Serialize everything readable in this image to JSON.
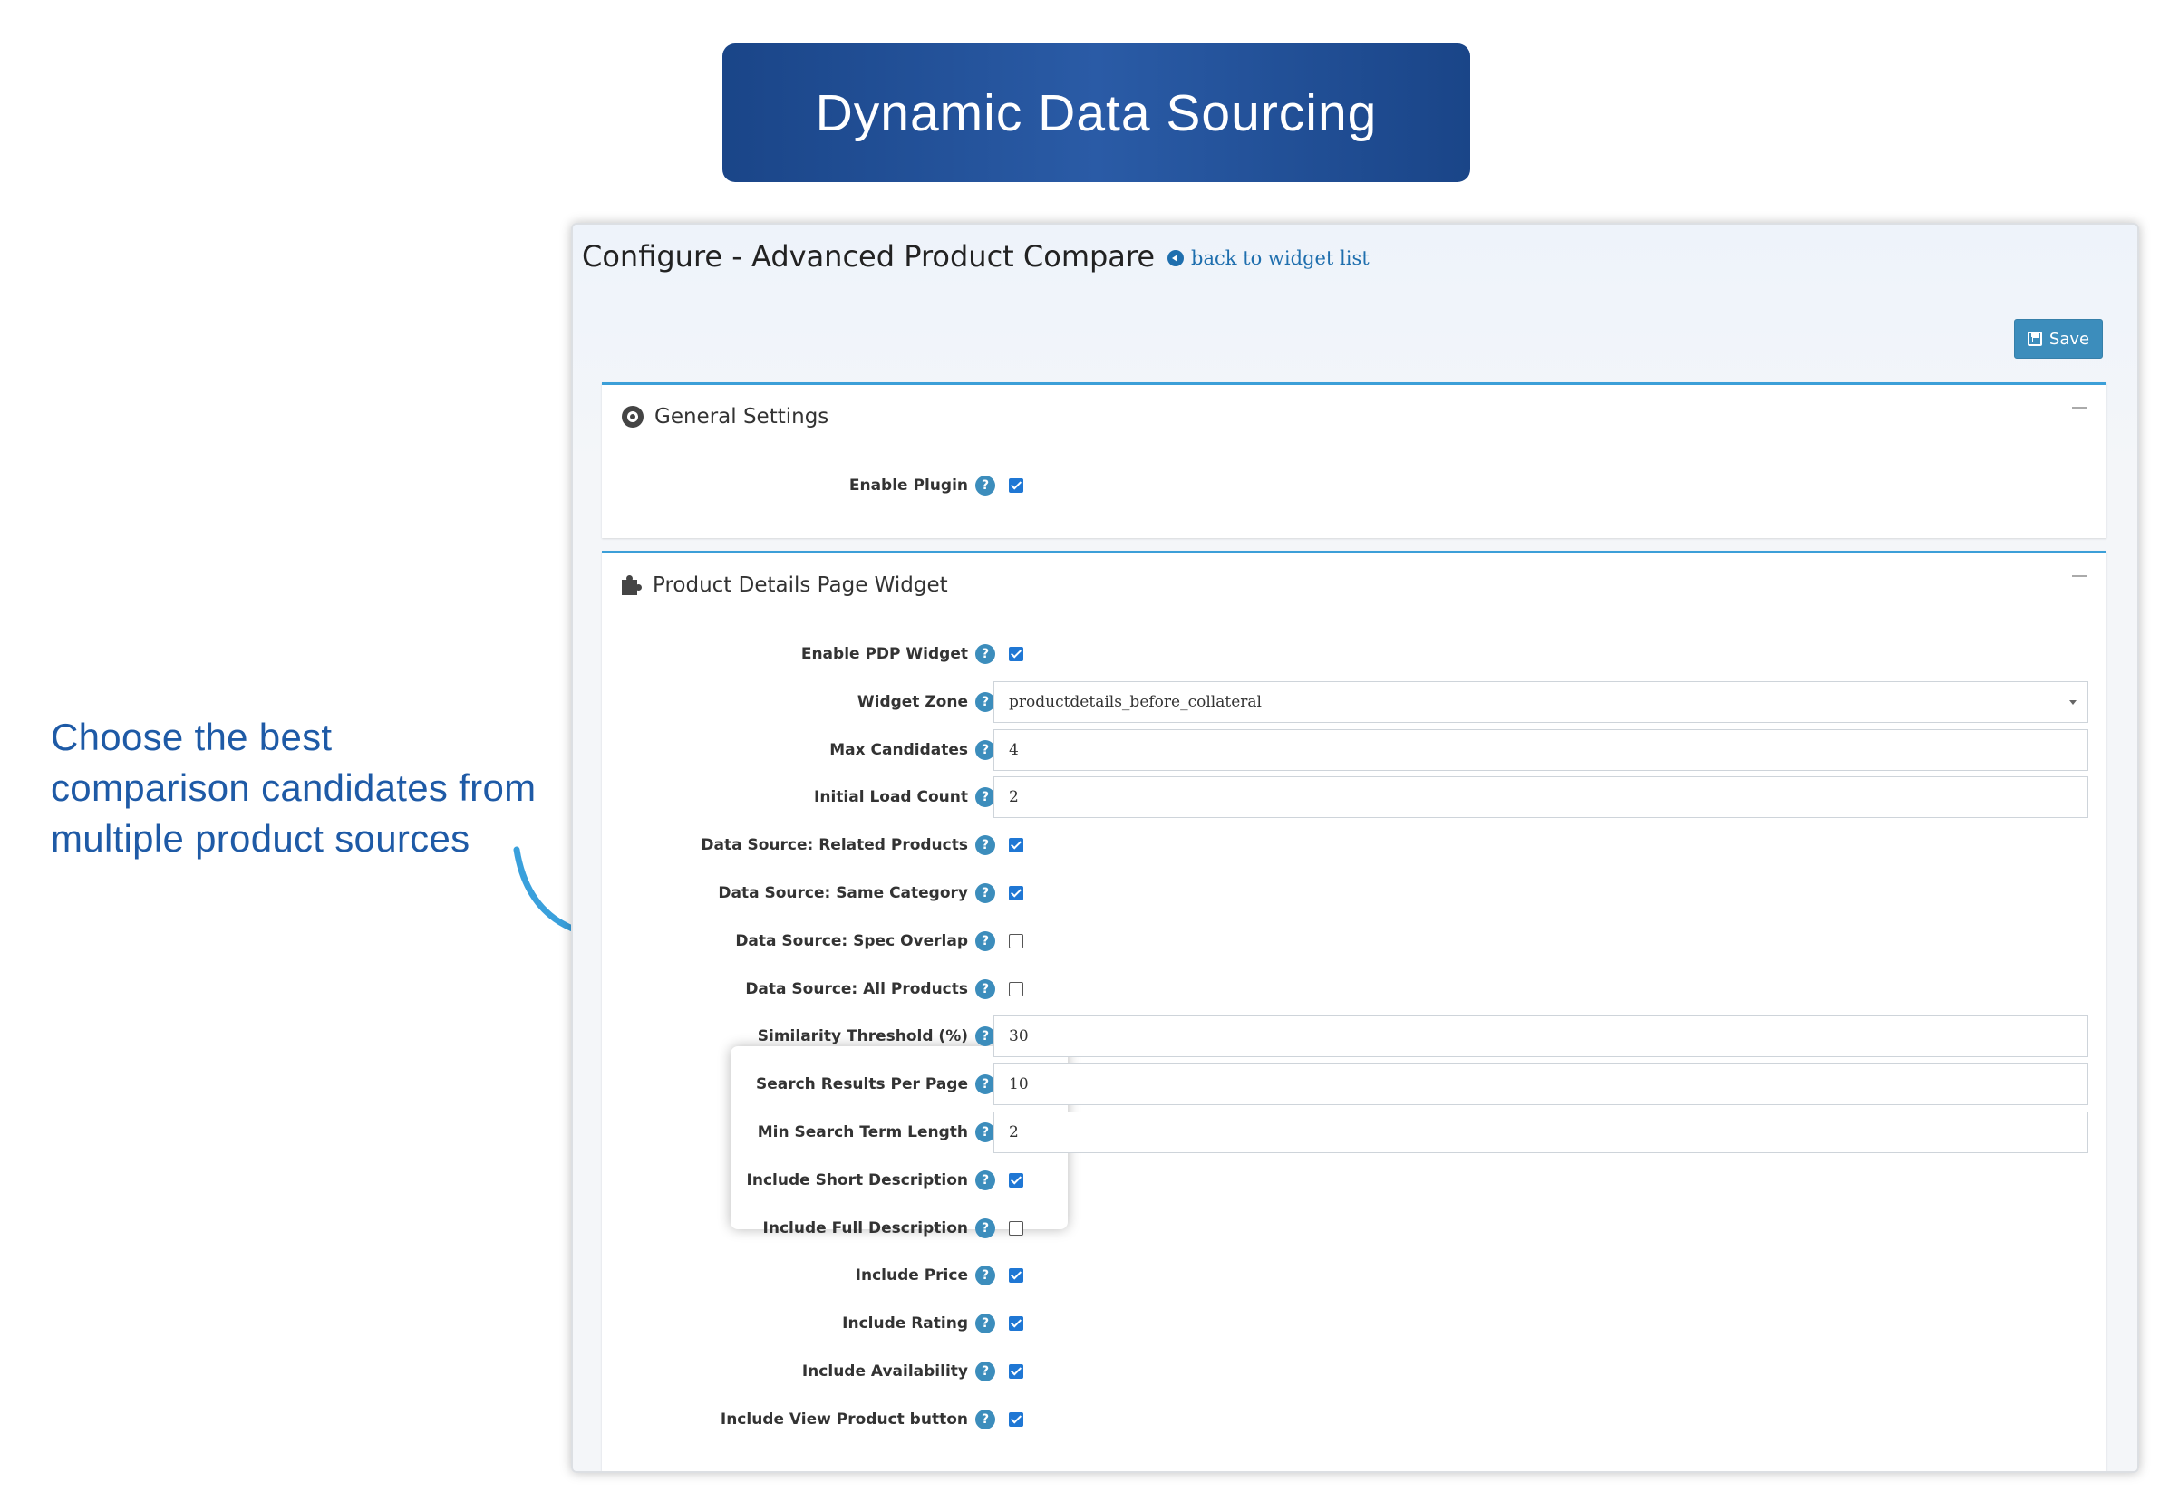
{
  "banner": {
    "title": "Dynamic Data Sourcing"
  },
  "annotation": {
    "text_lines": [
      "Choose the best",
      "comparison candidates from",
      "multiple product sources"
    ]
  },
  "header": {
    "title": "Configure - Advanced Product Compare",
    "back_link": "back to widget list"
  },
  "toolbar": {
    "save_label": "Save"
  },
  "general": {
    "title": "General Settings",
    "fields": [
      {
        "label": "Enable Plugin",
        "type": "checkbox",
        "checked": true
      }
    ]
  },
  "pdp": {
    "title": "Product Details Page Widget",
    "fields": [
      {
        "label": "Enable PDP Widget",
        "type": "checkbox",
        "checked": true
      },
      {
        "label": "Widget Zone",
        "type": "select",
        "value": "productdetails_before_collateral"
      },
      {
        "label": "Max Candidates",
        "type": "input",
        "value": "4"
      },
      {
        "label": "Initial Load Count",
        "type": "input",
        "value": "2"
      },
      {
        "label": "Data Source: Related Products",
        "type": "checkbox",
        "checked": true
      },
      {
        "label": "Data Source: Same Category",
        "type": "checkbox",
        "checked": true
      },
      {
        "label": "Data Source: Spec Overlap",
        "type": "checkbox",
        "checked": false
      },
      {
        "label": "Data Source: All Products",
        "type": "checkbox",
        "checked": false
      },
      {
        "label": "Similarity Threshold (%)",
        "type": "input",
        "value": "30"
      },
      {
        "label": "Search Results Per Page",
        "type": "input",
        "value": "10"
      },
      {
        "label": "Min Search Term Length",
        "type": "input",
        "value": "2"
      },
      {
        "label": "Include Short Description",
        "type": "checkbox",
        "checked": true
      },
      {
        "label": "Include Full Description",
        "type": "checkbox",
        "checked": false
      },
      {
        "label": "Include Price",
        "type": "checkbox",
        "checked": true
      },
      {
        "label": "Include Rating",
        "type": "checkbox",
        "checked": true
      },
      {
        "label": "Include Availability",
        "type": "checkbox",
        "checked": true
      },
      {
        "label": "Include View Product button",
        "type": "checkbox",
        "checked": true
      }
    ]
  },
  "help_glyph": "?",
  "colors": {
    "banner": "#1f4f96",
    "accent": "#3c8dbc",
    "annotation": "#1e5aa6",
    "card_border": "#3c9fd8",
    "checkbox": "#1f77d4"
  }
}
